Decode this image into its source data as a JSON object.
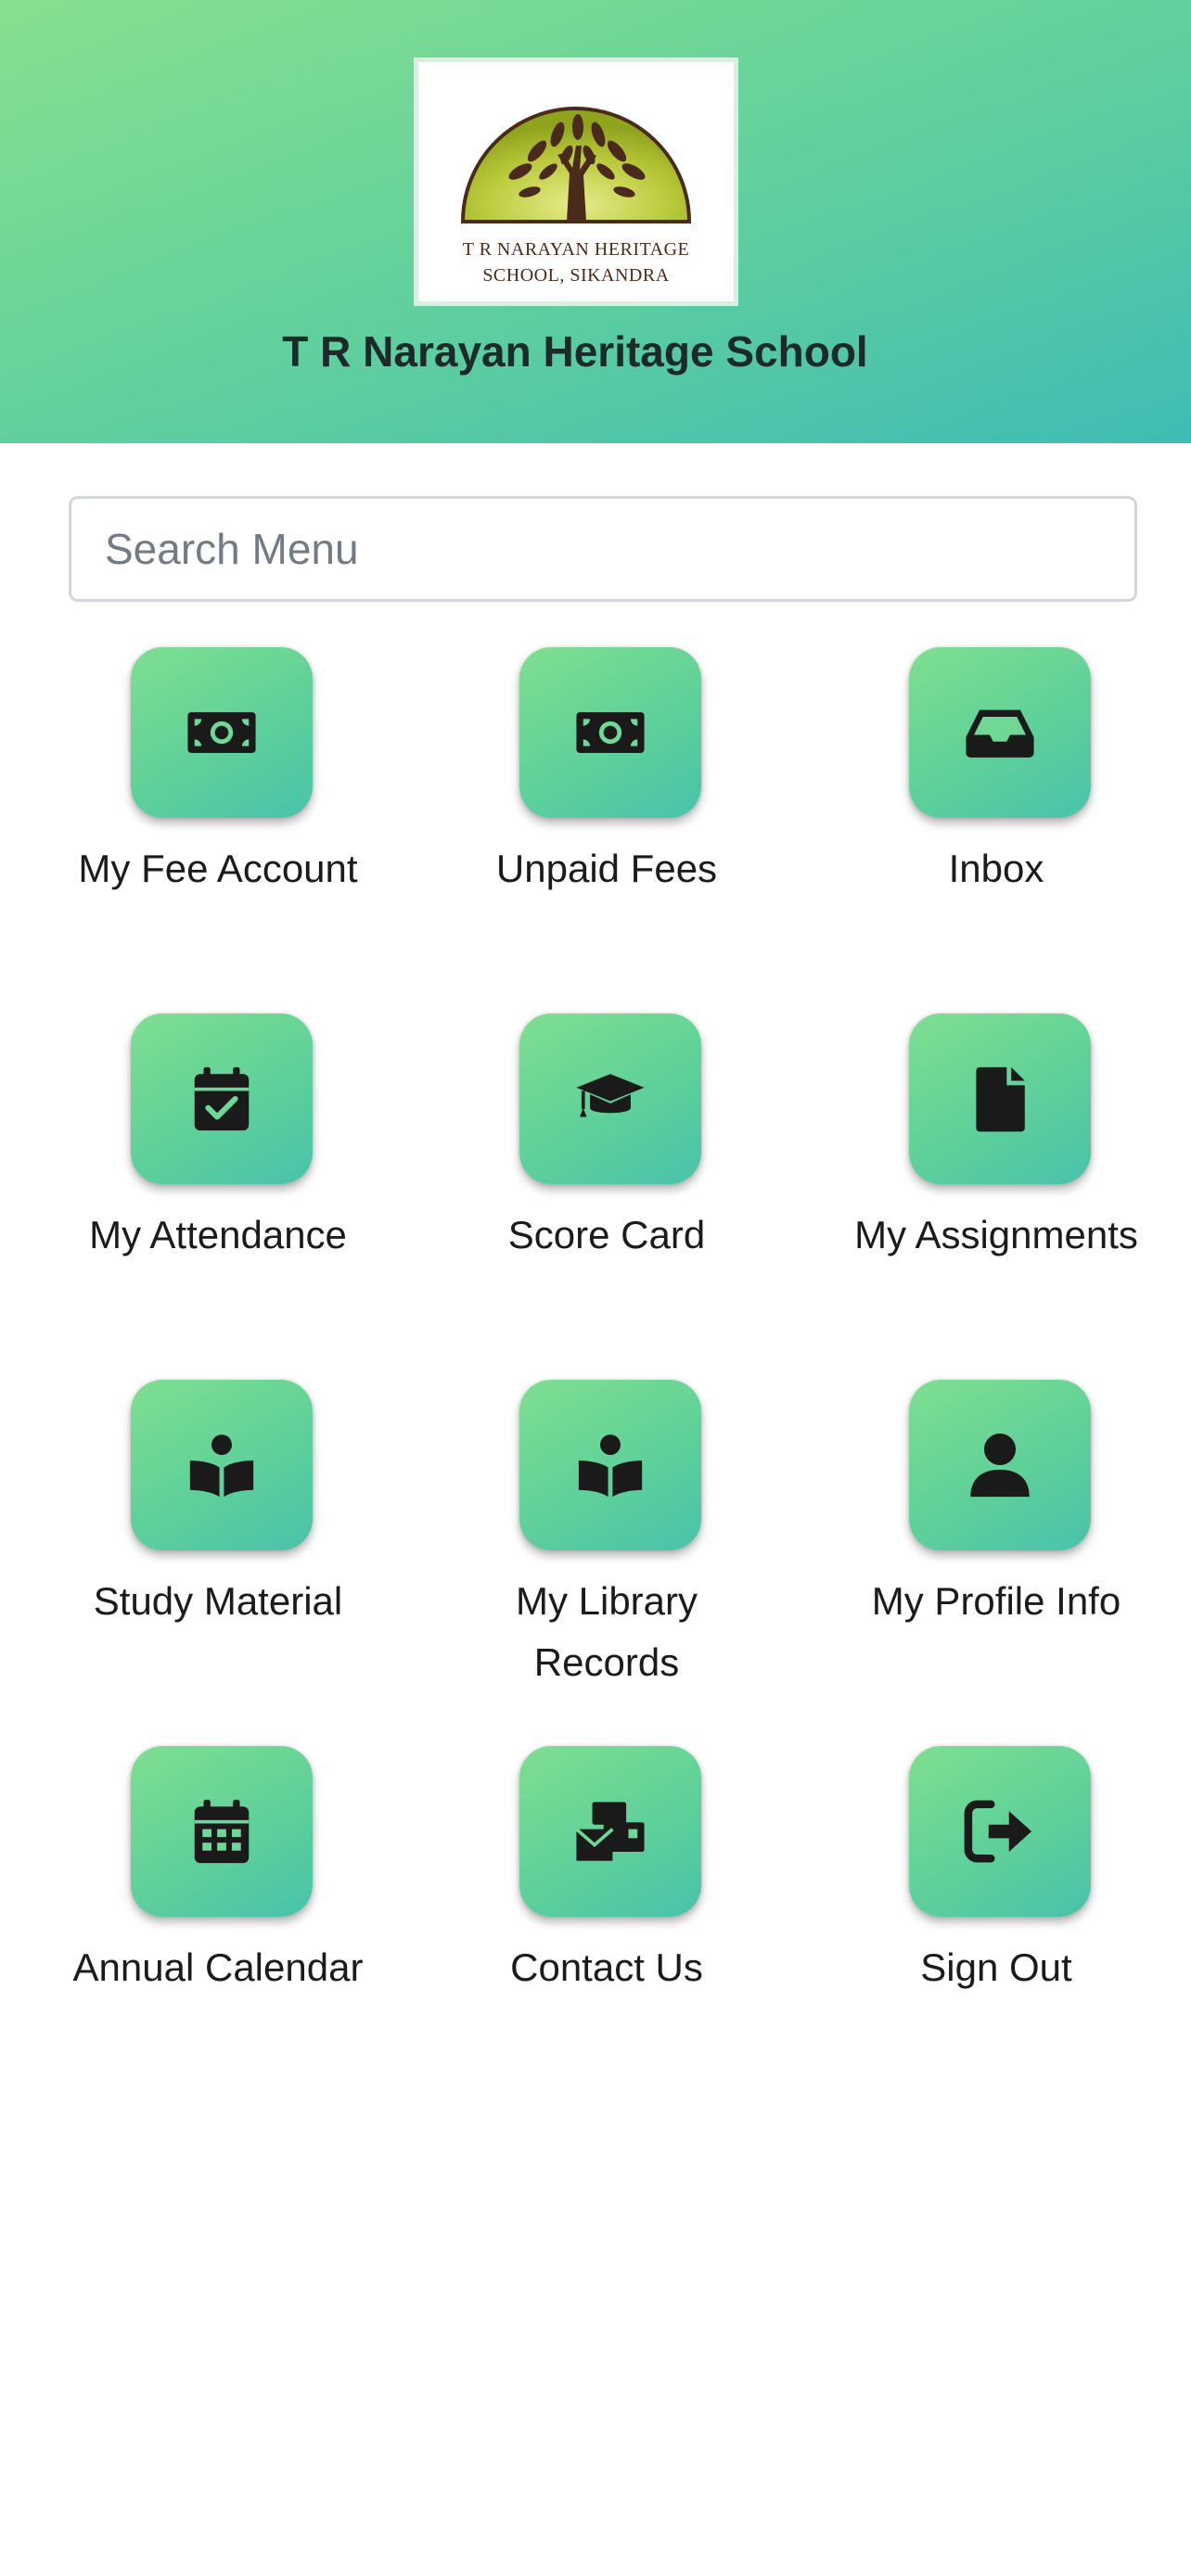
{
  "header": {
    "logo_line1": "T R NARAYAN HERITAGE",
    "logo_line2": "SCHOOL, SIKANDRA",
    "school_name": "T R Narayan Heritage School",
    "gradient_colors": [
      "#86e08e",
      "#3fbcb4"
    ]
  },
  "search": {
    "placeholder": "Search Menu",
    "value": ""
  },
  "menu": [
    {
      "label": "My Fee Account",
      "icon": "money-bill-icon"
    },
    {
      "label": "Unpaid Fees",
      "icon": "money-bill-icon"
    },
    {
      "label": "Inbox",
      "icon": "inbox-tray-icon"
    },
    {
      "label": "My Attendance",
      "icon": "calendar-check-icon"
    },
    {
      "label": "Score Card",
      "icon": "graduation-cap-icon"
    },
    {
      "label": "My Assignments",
      "icon": "file-icon"
    },
    {
      "label": "Study Material",
      "icon": "book-reader-icon"
    },
    {
      "label": "My Library Records",
      "icon": "book-reader-icon"
    },
    {
      "label": "My Profile Info",
      "icon": "user-icon"
    },
    {
      "label": "Annual Calendar",
      "icon": "calendar-icon"
    },
    {
      "label": "Contact Us",
      "icon": "mail-bulk-icon"
    },
    {
      "label": "Sign Out",
      "icon": "sign-out-icon"
    }
  ],
  "colors": {
    "tile_gradient": [
      "#7fdf90",
      "#49c2ac"
    ],
    "icon": "#1a1a1a"
  }
}
